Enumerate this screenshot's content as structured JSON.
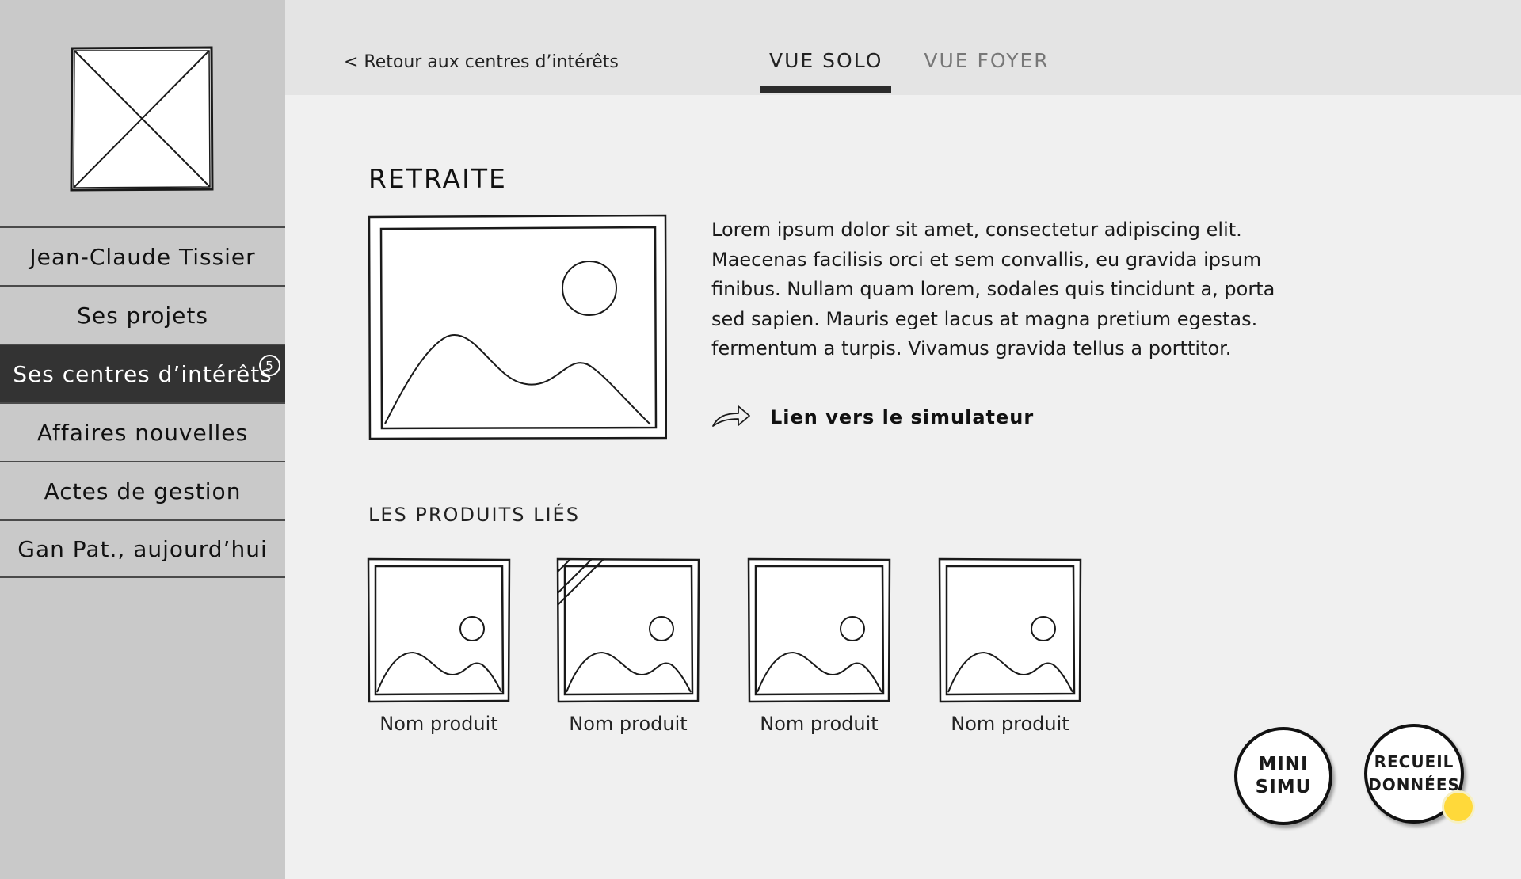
{
  "sidebar": {
    "logo_icon": "image-placeholder-icon",
    "items": [
      {
        "label": "Jean-Claude Tissier",
        "active": false
      },
      {
        "label": "Ses projets",
        "active": false
      },
      {
        "label": "Ses centres d’intérêts",
        "active": true,
        "badge": "5"
      },
      {
        "label": "Affaires nouvelles",
        "active": false
      },
      {
        "label": "Actes de gestion",
        "active": false
      },
      {
        "label": "Gan Pat., aujourd’hui",
        "active": false
      }
    ]
  },
  "header": {
    "back_link": "< Retour aux centres d’intérêts",
    "tabs": [
      {
        "label": "VUE SOLO",
        "active": true
      },
      {
        "label": "VUE FOYER",
        "active": false
      }
    ]
  },
  "main": {
    "title": "RETRAITE",
    "description": "Lorem ipsum dolor sit amet, consectetur adipiscing elit. Maecenas facilisis orci et sem convallis, eu gravida ipsum finibus. Nullam quam lorem, sodales quis tincidunt a, porta sed sapien. Mauris eget lacus at magna pretium egestas. fermentum a turpis. Vivamus gravida tellus a porttitor.",
    "simulator_link": "Lien vers le simulateur",
    "simulator_icon": "share-arrow-icon",
    "products_title": "LES PRODUITS LIÉS",
    "products": [
      {
        "name": "Nom produit"
      },
      {
        "name": "Nom produit"
      },
      {
        "name": "Nom produit"
      },
      {
        "name": "Nom produit"
      }
    ]
  },
  "fabs": {
    "mini_simu": [
      "MINI",
      "SIMU"
    ],
    "recueil": [
      "RECUEIL",
      "DONNÉES"
    ]
  },
  "colors": {
    "sidebar_bg": "#c9c9c9",
    "active_nav_bg": "#333333",
    "topbar_bg": "#e4e4e4",
    "content_bg": "#f0f0f0",
    "notification_dot": "#ffd93a"
  }
}
